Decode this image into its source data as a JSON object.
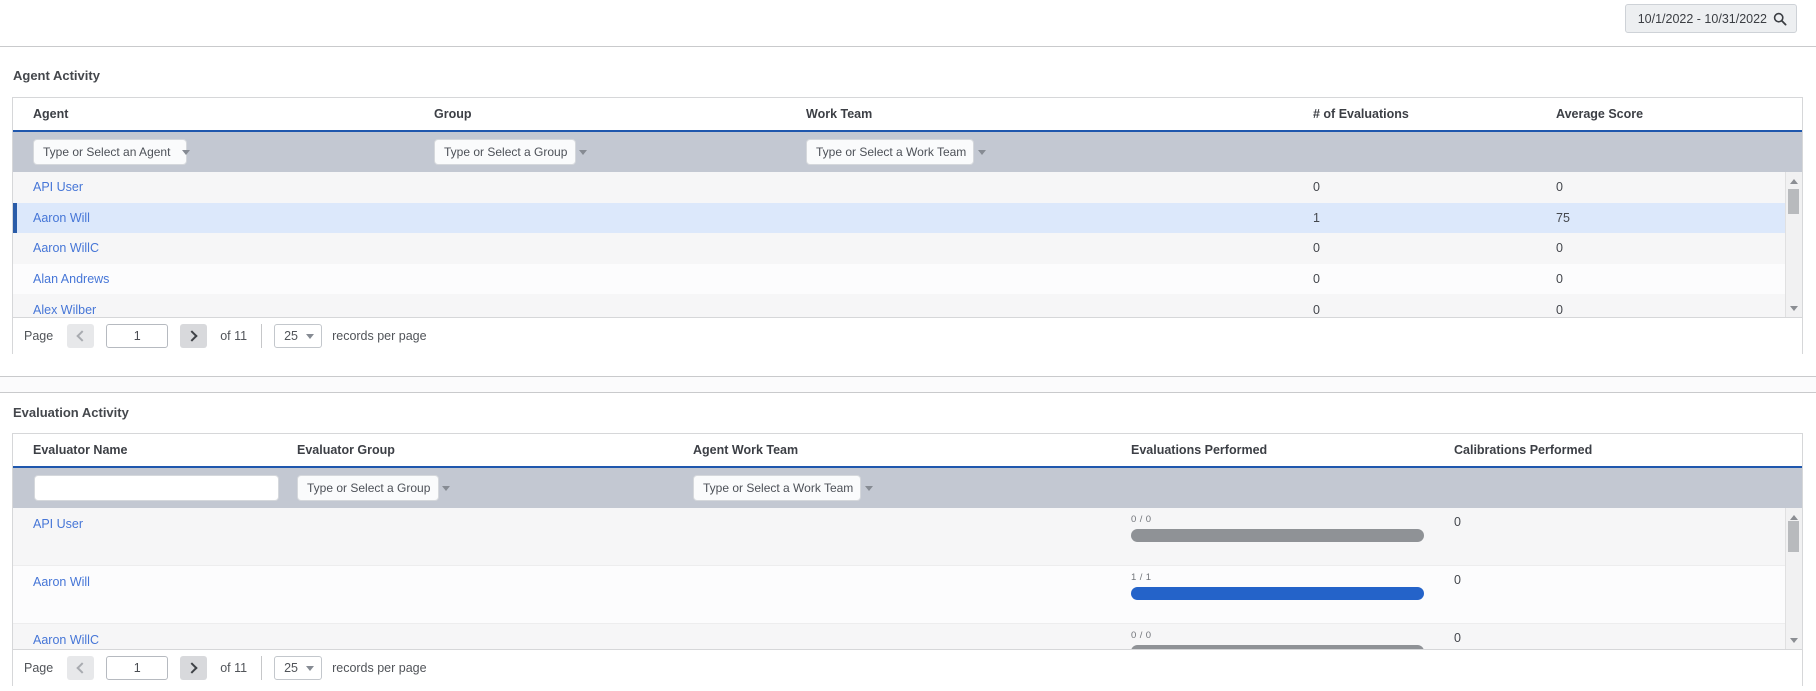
{
  "colors": {
    "header_underline_blue": "#1f57ad",
    "link_blue": "#4676d7",
    "selected_row_bg": "#dce8fb",
    "selected_row_bar": "#2a5ca8",
    "filter_row_bg": "#c3c8d2",
    "progress_blue": "#2463c9",
    "progress_gray": "#8f9296"
  },
  "topbar": {
    "date_range": "10/1/2022 - 10/31/2022"
  },
  "agent_activity": {
    "title": "Agent Activity",
    "columns": {
      "agent": "Agent",
      "group": "Group",
      "work_team": "Work Team",
      "evaluations": "# of Evaluations",
      "average_score": "Average Score"
    },
    "filters": {
      "agent": "Type or Select an Agent",
      "group": "Type or Select a Group",
      "work_team": "Type or Select a Work Team"
    },
    "rows": [
      {
        "agent": "API User",
        "evaluations": "0",
        "average_score": "0",
        "selected": false
      },
      {
        "agent": "Aaron Will",
        "evaluations": "1",
        "average_score": "75",
        "selected": true
      },
      {
        "agent": "Aaron WillC",
        "evaluations": "0",
        "average_score": "0",
        "selected": false
      },
      {
        "agent": "Alan Andrews",
        "evaluations": "0",
        "average_score": "0",
        "selected": false
      },
      {
        "agent": "Alex Wilber",
        "evaluations": "0",
        "average_score": "0",
        "selected": false
      }
    ],
    "pagination": {
      "page_label": "Page",
      "current_page": "1",
      "total_label": "of 11",
      "page_size": "25",
      "records_label": "records per page"
    }
  },
  "evaluation_activity": {
    "title": "Evaluation Activity",
    "columns": {
      "name": "Evaluator Name",
      "group": "Evaluator Group",
      "work_team": "Agent Work Team",
      "evaluations": "Evaluations Performed",
      "calibrations": "Calibrations Performed"
    },
    "filters": {
      "name_value": "",
      "group": "Type or Select a Group",
      "work_team": "Type or Select a Work Team"
    },
    "rows": [
      {
        "name": "API User",
        "progress_label": "0 / 0",
        "progress_color": "gray",
        "calibrations": "0"
      },
      {
        "name": "Aaron Will",
        "progress_label": "1 / 1",
        "progress_color": "blue",
        "calibrations": "0"
      },
      {
        "name": "Aaron WillC",
        "progress_label": "0 / 0",
        "progress_color": "gray",
        "calibrations": "0"
      }
    ],
    "pagination": {
      "page_label": "Page",
      "current_page": "1",
      "total_label": "of 11",
      "page_size": "25",
      "records_label": "records per page"
    }
  }
}
